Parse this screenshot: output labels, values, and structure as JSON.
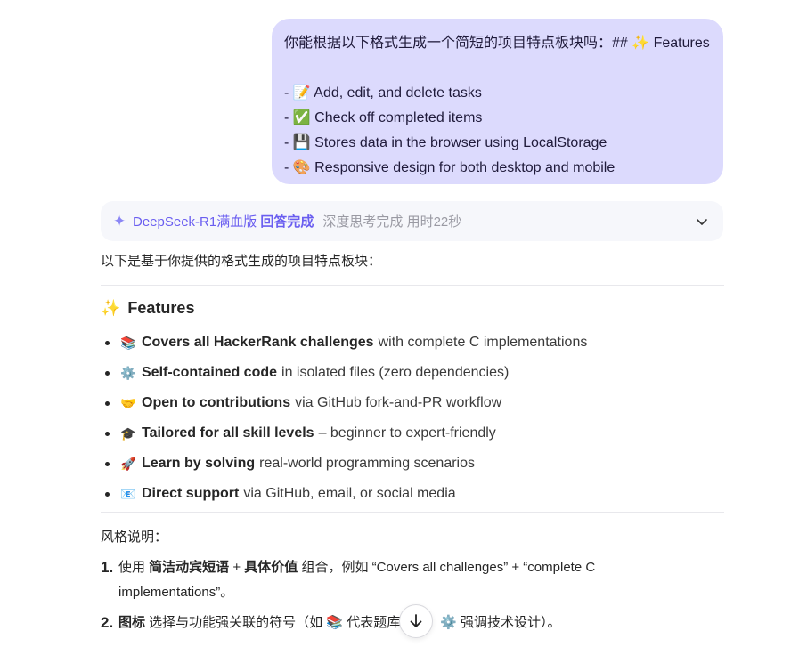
{
  "user_message": {
    "line1": "你能根据以下格式生成一个简短的项目特点板块吗：## ✨ Features",
    "items": [
      {
        "prefix": "- ",
        "emoji": "📝",
        "text": "Add, edit, and delete tasks"
      },
      {
        "prefix": "- ",
        "emoji": "✅",
        "text": "Check off completed items"
      },
      {
        "prefix": "- ",
        "emoji": "💾",
        "text": "Stores data in the browser using LocalStorage"
      },
      {
        "prefix": "- ",
        "emoji": "🎨",
        "text": "Responsive design for both desktop and mobile"
      }
    ]
  },
  "status": {
    "spark_icon": "✦",
    "model": "DeepSeek-R1满血版",
    "done": "回答完成",
    "thinking": "深度思考完成 用时22秒"
  },
  "answer": {
    "intro": "以下是基于你提供的格式生成的项目特点板块：",
    "features_emoji": "✨",
    "features_title": "Features",
    "features": [
      {
        "emoji": "📚",
        "bold": "Covers all HackerRank challenges",
        "rest": "with complete C implementations"
      },
      {
        "emoji": "⚙️",
        "bold": "Self-contained code",
        "rest": "in isolated files (zero dependencies)"
      },
      {
        "emoji": "🤝",
        "bold": "Open to contributions",
        "rest": "via GitHub fork-and-PR workflow"
      },
      {
        "emoji": "🎓",
        "bold": "Tailored for all skill levels",
        "rest": "– beginner to expert-friendly"
      },
      {
        "emoji": "🚀",
        "bold": "Learn by solving",
        "rest": "real-world programming scenarios"
      },
      {
        "emoji": "📧",
        "bold": "Direct support",
        "rest": "via GitHub, email, or social media"
      }
    ],
    "style_title": "风格说明：",
    "notes": [
      {
        "num": "1.",
        "pre": "使用 ",
        "b1": "简洁动宾短语",
        "mid": " + ",
        "b2": "具体价值",
        "post": " 组合，例如 “Covers all challenges” + “complete C implementations”。"
      },
      {
        "num": "2.",
        "b1": "图标",
        "post": " 选择与功能强关联的符号（如 📚 代表题库覆盖，⚙️ 强调技术设计）。"
      }
    ]
  },
  "scroll_button_icon": "arrow-down-icon"
}
